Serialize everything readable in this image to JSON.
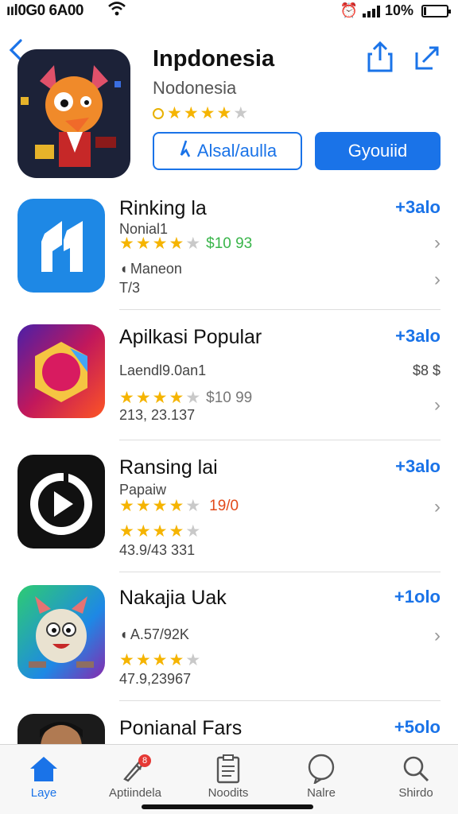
{
  "status_bar": {
    "carrier": "ııl0G0 6A00",
    "battery_text": "10%",
    "battery_level": 0.1
  },
  "header": {
    "title": "Inpdonesia",
    "subtitle": "Nodonesia",
    "rating": 4,
    "outline_button": "Alsal/aulla",
    "primary_button": "Gyouiid"
  },
  "apps": [
    {
      "name": "Rinking la",
      "price": "+3alo",
      "line1": "Nonial1",
      "rating": 4,
      "rating_text": "$10 93",
      "line3": "Maneon",
      "line4": "T/3"
    },
    {
      "name": "Apilkasi Popular",
      "price": "+3alo",
      "line1": "Laendl9.0an1",
      "line1_right": "$8 $",
      "rating": 3.5,
      "rating_text": "$10 99",
      "line4": "213, 23.137"
    },
    {
      "name": "Ransing lai",
      "price": "+3alo",
      "line1": "Papaiw",
      "rating": 4,
      "rating_text": "19/0",
      "rating2": 4,
      "line4": "43.9/43 331"
    },
    {
      "name": "Nakajia Uak",
      "price": "+1olo",
      "line1": "A.57/92K",
      "rating": 4,
      "line4": "47.9,23967"
    },
    {
      "name": "Ponianal Fars",
      "price": "+5olo"
    }
  ],
  "tabs": [
    {
      "label": "Laye",
      "icon": "home-icon"
    },
    {
      "label": "Aptiindela",
      "icon": "rocket-icon",
      "badge": "8"
    },
    {
      "label": "Noodits",
      "icon": "clipboard-icon"
    },
    {
      "label": "Nalre",
      "icon": "chat-icon"
    },
    {
      "label": "Shirdo",
      "icon": "search-icon"
    }
  ],
  "colors": {
    "accent": "#1a73e8",
    "star": "#f5b400",
    "green": "#39b54a"
  }
}
